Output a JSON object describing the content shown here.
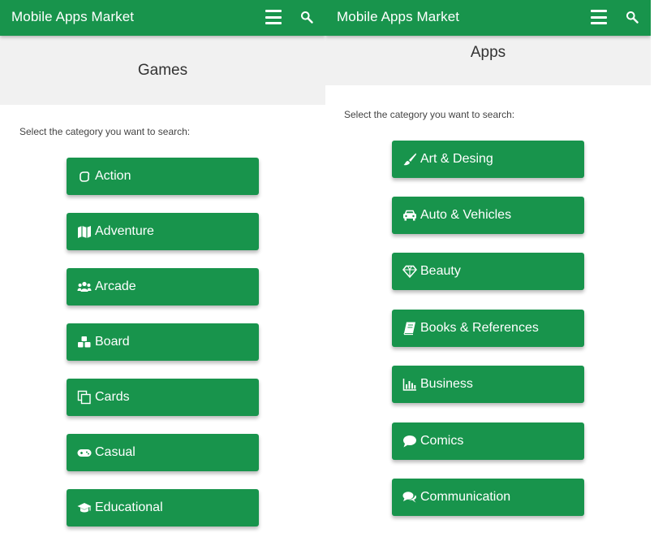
{
  "colors": {
    "primary": "#18944c",
    "band": "#f1f1f1",
    "text": "#333333"
  },
  "left": {
    "app_title": "Mobile Apps Market",
    "heading": "Games",
    "prompt": "Select the category you want to search:",
    "categories": [
      {
        "label": "Action",
        "icon": "hand-icon"
      },
      {
        "label": "Adventure",
        "icon": "map-icon"
      },
      {
        "label": "Arcade",
        "icon": "users-icon"
      },
      {
        "label": "Board",
        "icon": "cubes-icon"
      },
      {
        "label": "Cards",
        "icon": "copy-icon"
      },
      {
        "label": "Casual",
        "icon": "gamepad-icon"
      },
      {
        "label": "Educational",
        "icon": "graduation-cap-icon"
      }
    ]
  },
  "right": {
    "app_title": "Mobile Apps Market",
    "heading": "Apps",
    "prompt": "Select the category you want to search:",
    "categories": [
      {
        "label": "Art & Desing",
        "icon": "paint-brush-icon"
      },
      {
        "label": "Auto & Vehicles",
        "icon": "car-icon"
      },
      {
        "label": "Beauty",
        "icon": "diamond-icon"
      },
      {
        "label": "Books & References",
        "icon": "book-icon"
      },
      {
        "label": "Business",
        "icon": "bar-chart-icon"
      },
      {
        "label": "Comics",
        "icon": "comment-icon"
      },
      {
        "label": "Communication",
        "icon": "comments-icon"
      }
    ]
  }
}
